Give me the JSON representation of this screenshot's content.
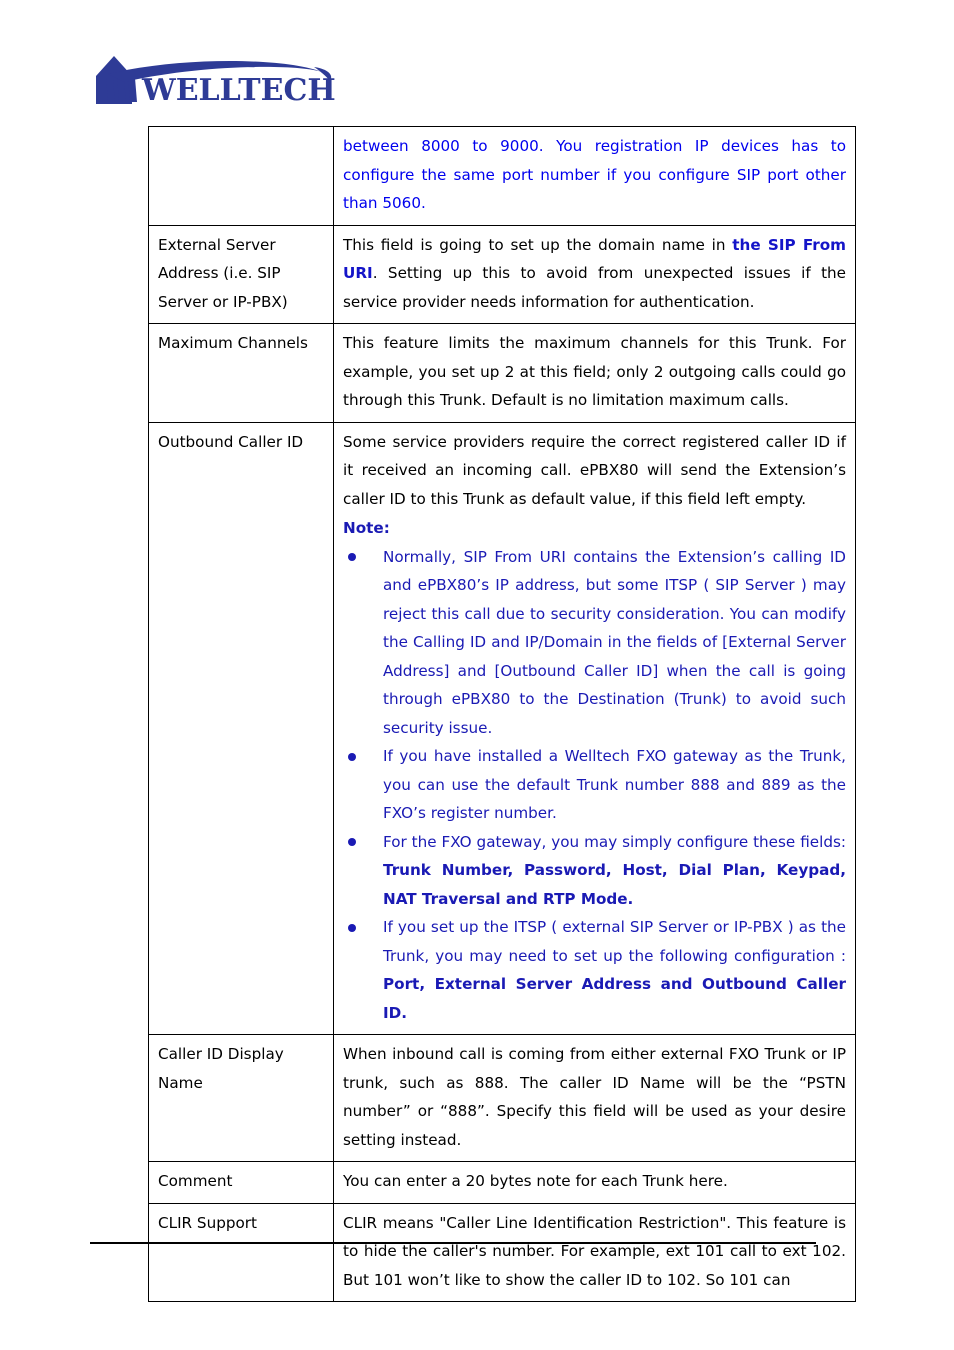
{
  "page": {
    "brand_name": "WELLTECH",
    "brand_color": "#2e3b96"
  },
  "colors": {
    "body_blue": "#0000ee",
    "note_navy": "#1a1ab4",
    "bold_blue": "#1414c8",
    "text_black": "#000000",
    "border": "#000000"
  },
  "table": {
    "rows": [
      {
        "label": "",
        "description_runs": [
          {
            "text": "between 8000 to 9000. You registration IP devices has to configure the same port number if you configure SIP port other than 5060.",
            "style": "blue"
          }
        ]
      },
      {
        "label": "External Server Address (i.e. SIP Server or IP-PBX)",
        "description_runs": [
          {
            "text": "This field is going to set up the domain name in ",
            "style": "plain"
          },
          {
            "text": "the SIP From URI",
            "style": "blue-bold"
          },
          {
            "text": ". Setting up this to avoid from unexpected issues if the service provider needs information for authentication.",
            "style": "plain"
          }
        ]
      },
      {
        "label": "Maximum Channels",
        "description_runs": [
          {
            "text": "This feature limits the maximum channels for this Trunk. For example, you set up 2 at this field; only 2 outgoing calls could go through this Trunk. Default is no limitation maximum calls.",
            "style": "plain"
          }
        ]
      },
      {
        "label": "Outbound Caller ID",
        "description_runs": [
          {
            "text": "Some service providers require the correct registered caller ID if it received an incoming call. ePBX80 will send the Extension’s caller ID to this Trunk as default value, if this field left empty.",
            "style": "plain"
          }
        ],
        "note_heading": "Note:",
        "note_bullets": [
          {
            "runs": [
              {
                "text": "Normally, SIP From URI contains the Extension’s calling ID and ePBX80’s IP address, but some ITSP ( SIP Server ) may reject this call due to security consideration. You can modify the Calling ID and IP/Domain in the fields of [External Server Address] and [Outbound Caller ID] when the call is going through ePBX80 to the Destination (Trunk) to avoid such security issue.",
                "style": "navy"
              }
            ]
          },
          {
            "runs": [
              {
                "text": "If you have installed a Welltech FXO gateway as the Trunk, you can use the default Trunk number 888 and 889 as the FXO’s register number.",
                "style": "navy"
              }
            ]
          },
          {
            "runs": [
              {
                "text": "For the FXO gateway, you may simply configure these fields: ",
                "style": "navy"
              },
              {
                "text": "Trunk Number, Password, Host, Dial Plan, Keypad, NAT Traversal and RTP Mode.",
                "style": "navy-bold"
              }
            ]
          },
          {
            "runs": [
              {
                "text": "If you set up the ITSP ( external SIP Server or IP-PBX ) as the Trunk, you may need to set up the following configuration : ",
                "style": "navy"
              },
              {
                "text": "Port, External Server Address and Outbound Caller ID.",
                "style": "navy-bold"
              }
            ]
          }
        ]
      },
      {
        "label": "Caller ID Display Name",
        "description_runs": [
          {
            "text": "When inbound call is coming from either external FXO Trunk or IP trunk, such as 888. The caller ID Name will be the “PSTN number” or “888”. Specify this field will be used as your desire setting instead.",
            "style": "plain"
          }
        ]
      },
      {
        "label": "Comment",
        "description_runs": [
          {
            "text": "You can enter a 20 bytes note for each Trunk here.",
            "style": "plain"
          }
        ]
      },
      {
        "label": "CLIR Support",
        "description_runs": [
          {
            "text": "CLIR means \"Caller Line Identification Restriction\". This feature is to hide the caller's number. For example, ext 101 call to ext 102. But 101 won’t like to show the caller ID to 102. So 101 can",
            "style": "plain"
          }
        ]
      }
    ]
  }
}
